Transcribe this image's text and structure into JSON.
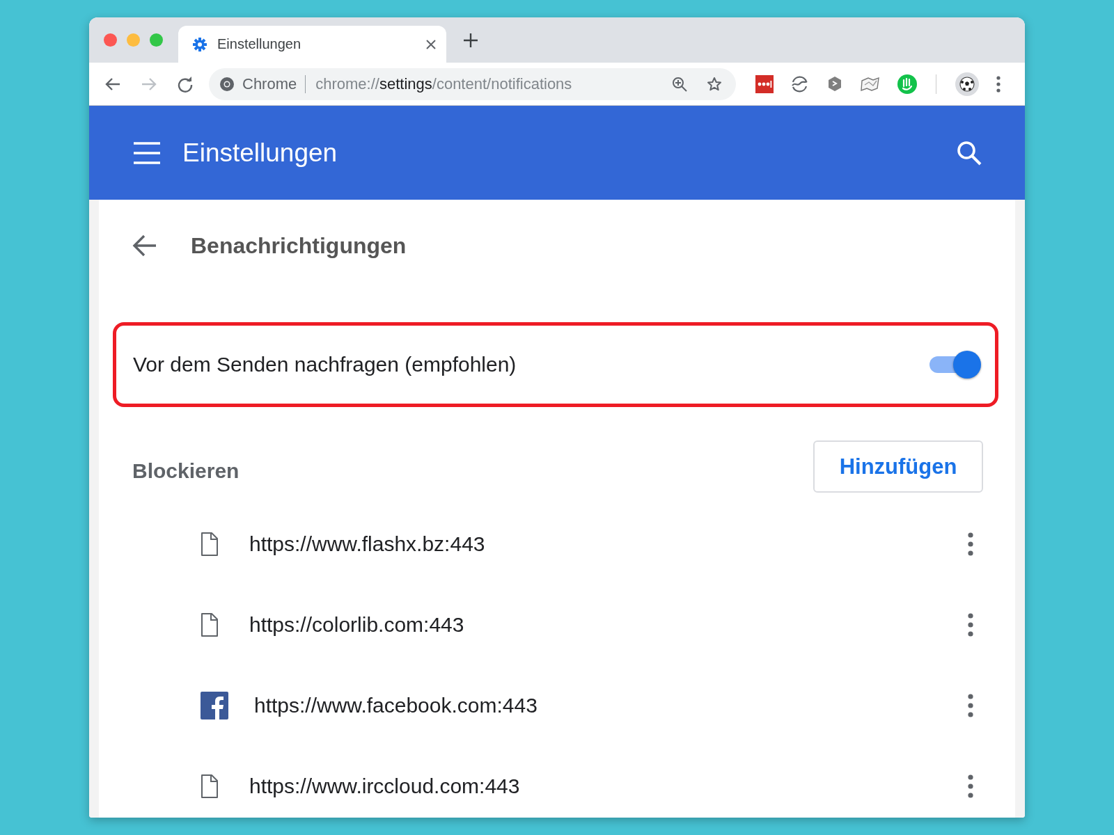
{
  "tab": {
    "title": "Einstellungen",
    "selected": true
  },
  "omnibox": {
    "site_label": "Chrome",
    "url_scheme": "chrome://",
    "url_host": "settings",
    "url_path": "/content/notifications"
  },
  "header": {
    "title": "Einstellungen"
  },
  "subpage": {
    "title": "Benachrichtigungen"
  },
  "ask_setting": {
    "label": "Vor dem Senden nachfragen (empfohlen)",
    "on": true
  },
  "block_section": {
    "title": "Blockieren",
    "add_button": "Hinzufügen"
  },
  "blocked_sites": [
    {
      "kind": "file",
      "url": "https://www.flashx.bz:443"
    },
    {
      "kind": "file",
      "url": "https://colorlib.com:443"
    },
    {
      "kind": "facebook",
      "url": "https://www.facebook.com:443"
    },
    {
      "kind": "file",
      "url": "https://www.irccloud.com:443"
    }
  ]
}
